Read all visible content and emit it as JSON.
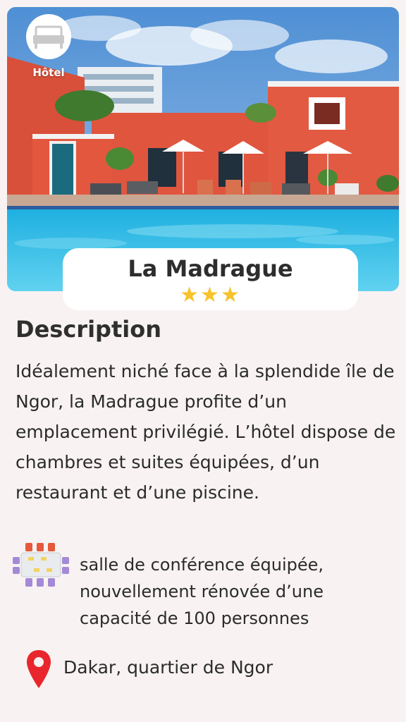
{
  "badge": {
    "label": "Hôtel",
    "icon": "bed-icon"
  },
  "hotel": {
    "name": "La Madrague",
    "stars": "★★★",
    "star_count": 3,
    "star_color": "#f6c32c"
  },
  "description": {
    "heading": "Description",
    "text": "Idéalement niché face à la splendide île de Ngor,  la Madrague profite d’un emplacement privilégié. L’hôtel dispose de chambres et suites équipées, d’un restaurant et d’une piscine."
  },
  "feature": {
    "icon": "conference-table-icon",
    "text": "salle de conférence équipée, nouvellement rénovée d’une capacité de 100 personnes"
  },
  "location": {
    "icon": "map-pin-icon",
    "text": "Dakar, quartier de Ngor",
    "pin_color": "#e8262c"
  },
  "colors": {
    "background": "#f8f3f2",
    "pool": "#3fc3e8",
    "walls": "#e0553e",
    "sky": "#5e98d6"
  }
}
